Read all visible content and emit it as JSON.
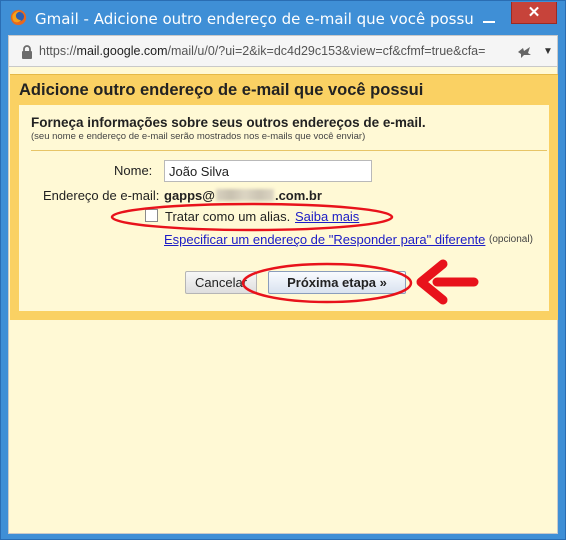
{
  "window": {
    "title": "Gmail - Adicione outro endereço de e-mail que você possui - M...",
    "close_glyph": "✕"
  },
  "address_bar": {
    "url_scheme": "https://",
    "url_host": "mail.google.com",
    "url_rest": "/mail/u/0/?ui=2&ik=dc4d29c153&view=cf&cfmf=true&cfa="
  },
  "dialog": {
    "title": "Adicione outro endereço de e-mail que você possui",
    "intro_title": "Forneça informações sobre seus outros endereços de e-mail.",
    "intro_subtitle": "(seu nome e endereço de e-mail serão mostrados nos e-mails que você enviar)",
    "name_label": "Nome:",
    "name_value": "João Silva",
    "email_label": "Endereço de e-mail:",
    "email_prefix": "gapps@",
    "email_suffix": ".com.br",
    "alias_label": "Tratar como um alias.",
    "alias_link": "Saiba mais",
    "alias_checked": false,
    "replyto_link": "Especificar um endereço de \"Responder para\" diferente",
    "replyto_optional": "(opcional)",
    "cancel_button": "Cancelar",
    "next_button": "Próxima etapa »"
  },
  "colors": {
    "titlebar": "#3f8fd6",
    "close_button": "#c7433a",
    "dialog_header": "#fad163",
    "dialog_background": "#fff9d5",
    "link": "#1c1cc6",
    "annotation": "#e8121b"
  }
}
